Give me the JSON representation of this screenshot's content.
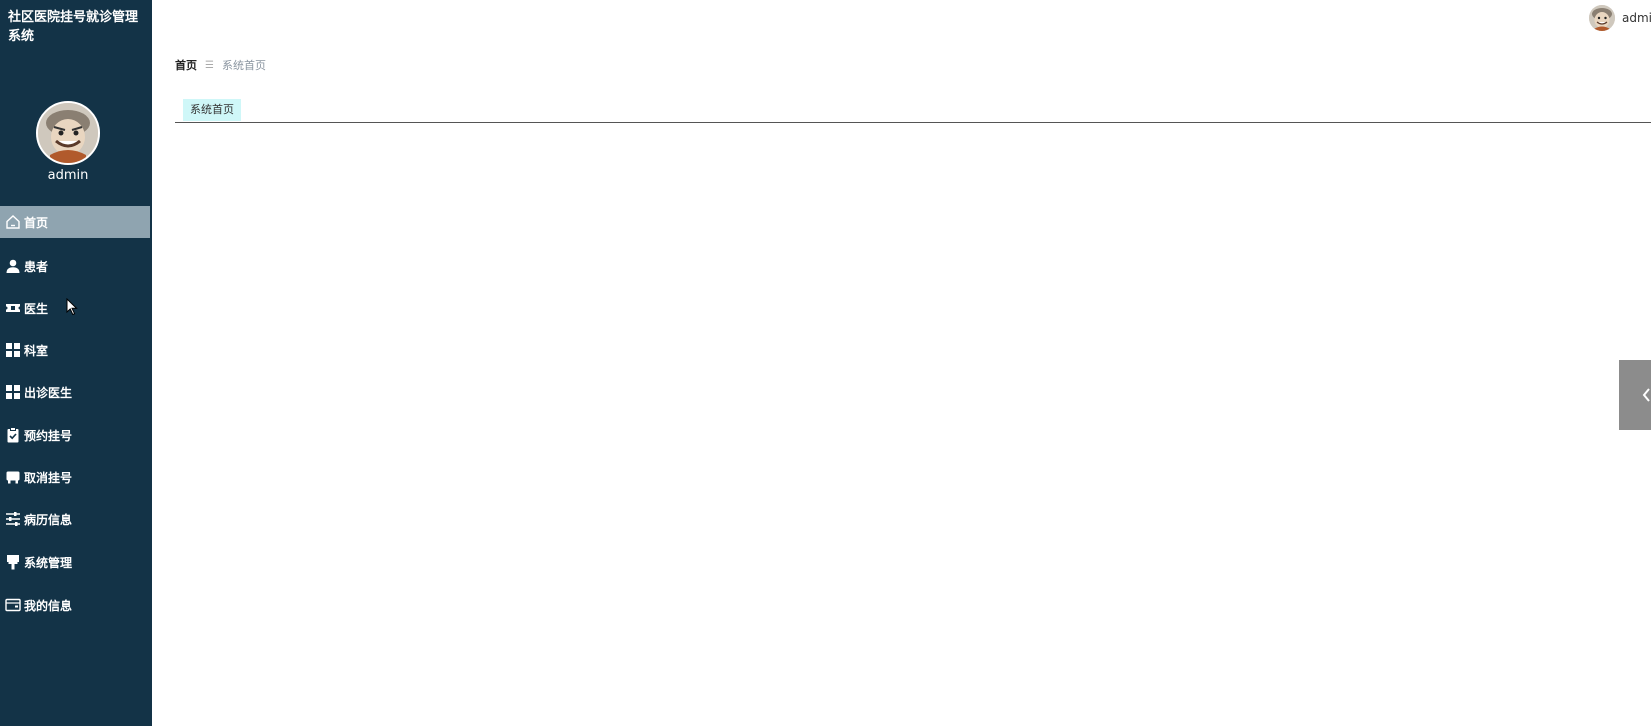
{
  "app": {
    "title": "社区医院挂号就诊管理系统"
  },
  "sidebar": {
    "username": "admin",
    "items": [
      {
        "label": "首页",
        "icon": "home-icon",
        "active": true
      },
      {
        "label": "患者",
        "icon": "person-icon"
      },
      {
        "label": "医生",
        "icon": "ticket-icon"
      },
      {
        "label": "科室",
        "icon": "grid-icon"
      },
      {
        "label": "出诊医生",
        "icon": "grid-icon"
      },
      {
        "label": "预约挂号",
        "icon": "clipboard-check-icon"
      },
      {
        "label": "取消挂号",
        "icon": "tray-icon"
      },
      {
        "label": "病历信息",
        "icon": "sliders-icon"
      },
      {
        "label": "系统管理",
        "icon": "brush-icon"
      },
      {
        "label": "我的信息",
        "icon": "wallet-icon"
      }
    ]
  },
  "topbar": {
    "username": "admi"
  },
  "breadcrumb": {
    "home": "首页",
    "separator": "☰",
    "current": "系统首页"
  },
  "tabs": [
    {
      "label": "系统首页"
    }
  ],
  "colors": {
    "sidebar_bg": "#133347",
    "active_item_bg": "#8fa4b0",
    "tab_bg": "#cff7f8",
    "handle_bg": "#8c8c8c"
  }
}
